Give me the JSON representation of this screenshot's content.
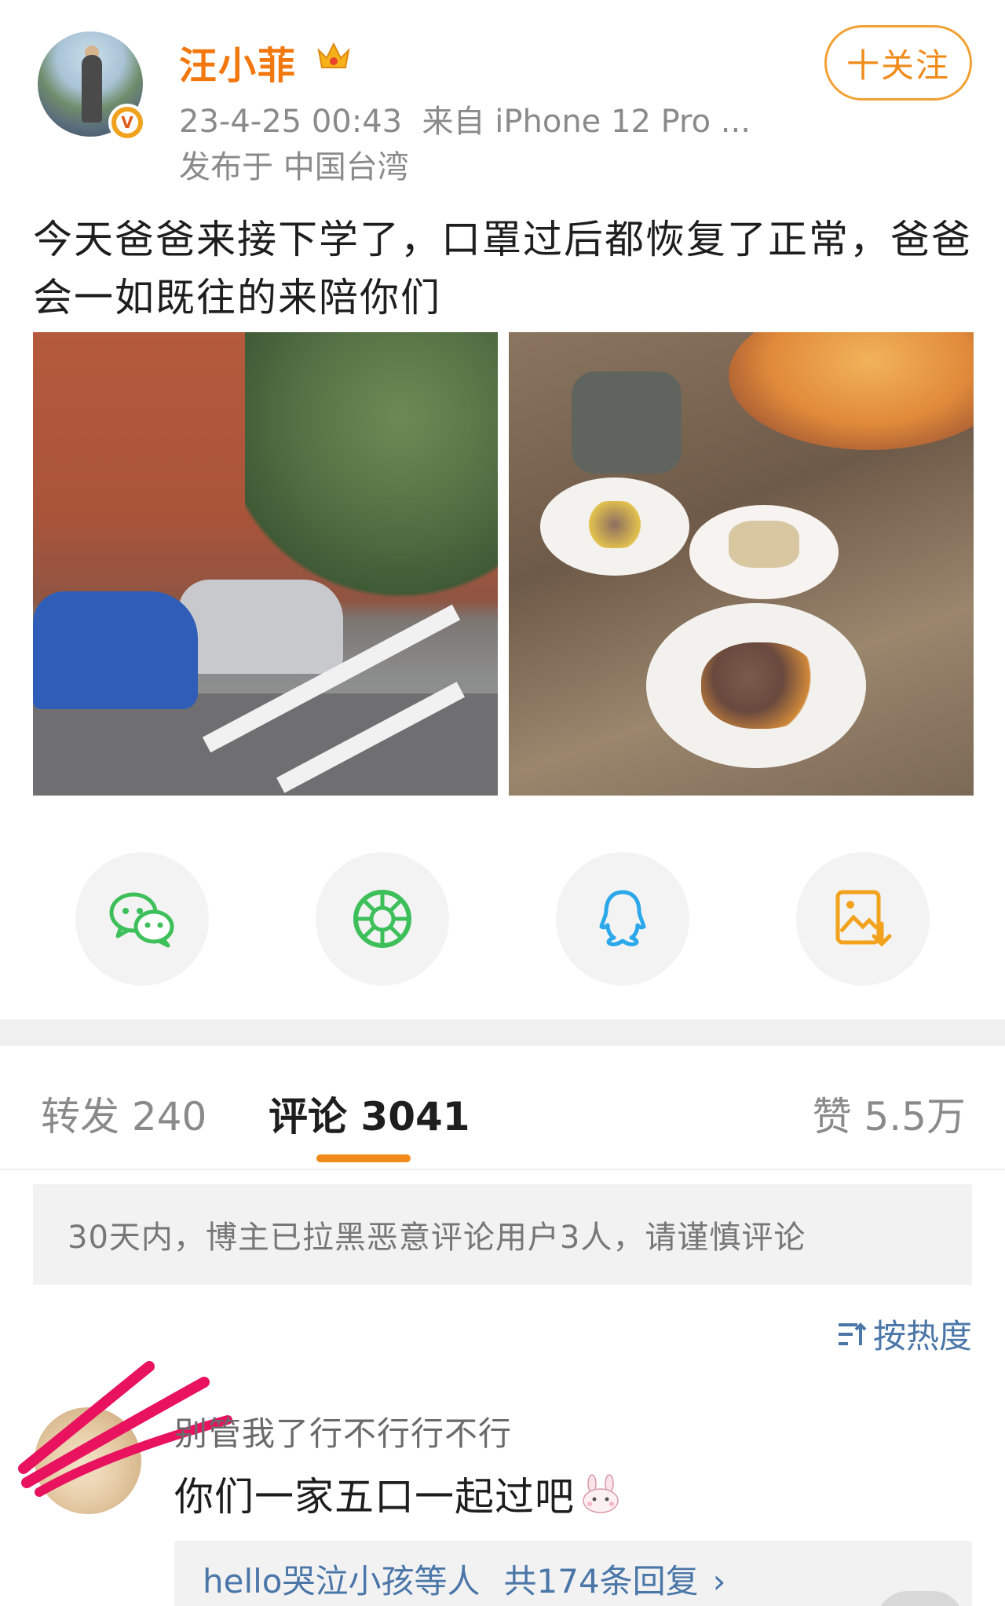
{
  "post": {
    "username": "汪小菲",
    "timestamp": "23-4-25 00:43",
    "source": "来自 iPhone 12 Pro ...",
    "location": "发布于 中国台湾",
    "follow_label": "十关注",
    "text": "今天爸爸来接下学了，口罩过后都恢复了正常，爸爸会一如既往的来陪你们",
    "badge": "V",
    "icons": {
      "crown": "crown-icon",
      "verified": "verified-v-icon"
    }
  },
  "share": {
    "icons": [
      "wechat-icon",
      "moments-icon",
      "qq-icon",
      "save-image-icon"
    ],
    "colors": {
      "wechat": "#3dbf5a",
      "moments": "#3dbf5a",
      "qq": "#2aa8ea",
      "save": "#f2a21c"
    }
  },
  "tabs": {
    "repost": "转发 240",
    "comments": "评论 3041",
    "likes": "赞 5.5万"
  },
  "notice": "30天内，博主已拉黑恶意评论用户3人，请谨慎评论",
  "sort": {
    "label": "按热度",
    "icon": "sort-icon"
  },
  "comment": {
    "username": "别管我了行不行行不行",
    "text": "你们一家五口一起过吧",
    "emoji": "bunny-emoji-icon",
    "replies_users": "hello哭泣小孩等人",
    "replies_count": "共174条回复",
    "chevron": "›"
  },
  "colors": {
    "accent": "#f08b1a",
    "link": "#4a76a8",
    "username": "#f2770d",
    "scribble": "#e8125e"
  }
}
